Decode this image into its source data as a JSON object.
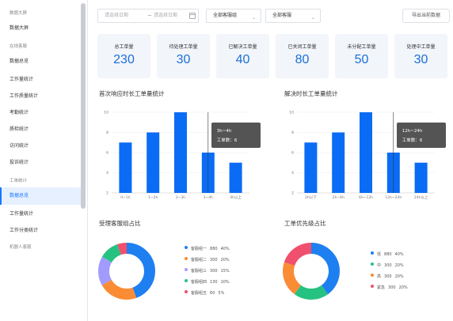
{
  "sidebar": {
    "items": [
      {
        "label": "数据大屏",
        "type": "group"
      },
      {
        "label": "数据大屏",
        "type": "item"
      },
      {
        "label": "在线客服",
        "type": "group"
      },
      {
        "label": "数据总览",
        "type": "item"
      },
      {
        "label": "工作量统计",
        "type": "item"
      },
      {
        "label": "工作质量统计",
        "type": "item"
      },
      {
        "label": "考勤统计",
        "type": "item"
      },
      {
        "label": "质检统计",
        "type": "item"
      },
      {
        "label": "访问统计",
        "type": "item"
      },
      {
        "label": "投诉统计",
        "type": "item"
      },
      {
        "label": "工单统计",
        "type": "group"
      },
      {
        "label": "数据总览",
        "type": "active"
      },
      {
        "label": "工作量统计",
        "type": "item"
      },
      {
        "label": "工作分类统计",
        "type": "item"
      },
      {
        "label": "机器人客服",
        "type": "group"
      }
    ]
  },
  "filters": {
    "start_date_placeholder": "请选择日期",
    "separator": "~",
    "end_date_placeholder": "请选择日期",
    "group_select": "全部客服组",
    "agent_select": "全部客服",
    "export_label": "导出当前数据"
  },
  "stats": [
    {
      "label": "总工单量",
      "value": "230"
    },
    {
      "label": "待处理工单量",
      "value": "30"
    },
    {
      "label": "已解决工单量",
      "value": "40"
    },
    {
      "label": "已关闭工单量",
      "value": "80"
    },
    {
      "label": "未分配工单量",
      "value": "50"
    },
    {
      "label": "处理中工单量",
      "value": "30"
    }
  ],
  "colors": {
    "accent": "#1677ff",
    "bar": "#0a6cf5",
    "card_bg": "#f2f5fa",
    "value_text": "#1a6fd8"
  },
  "chart_data": [
    {
      "type": "bar",
      "title": "首次响应时长工单量统计",
      "categories": [
        "0~1h",
        "1~2h",
        "2~3h",
        "3~4h",
        "4h以上"
      ],
      "values": [
        7,
        8,
        10,
        6,
        5
      ],
      "ylim": [
        2,
        10
      ],
      "yticks": [
        "2",
        "4",
        "6",
        "8",
        "10"
      ],
      "highlight_index": 3,
      "tooltip": {
        "title": "3h~4h",
        "label": "工单数：",
        "value": "6"
      }
    },
    {
      "type": "bar",
      "title": "解决时长工单量统计",
      "categories": [
        "2h以下",
        "2h~6h",
        "6h~12h",
        "12h~24h",
        "24h以上"
      ],
      "values": [
        7,
        8,
        10,
        6,
        5
      ],
      "ylim": [
        2,
        10
      ],
      "yticks": [
        "2",
        "4",
        "6",
        "8",
        "10"
      ],
      "highlight_index": 3,
      "tooltip": {
        "title": "12h~24h",
        "label": "工单数：",
        "value": "6"
      }
    },
    {
      "type": "pie",
      "title": "受理客服组占比",
      "slices": [
        {
          "name": "客服组一",
          "count": "880",
          "pct": "40%",
          "value": 40,
          "color": "#1e7ff0"
        },
        {
          "name": "客服组二",
          "count": "300",
          "pct": "20%",
          "value": 20,
          "color": "#fa8c35"
        },
        {
          "name": "客服组三",
          "count": "300",
          "pct": "15%",
          "value": 15,
          "color": "#a29bfe"
        },
        {
          "name": "客服组四",
          "count": "130",
          "pct": "10%",
          "value": 10,
          "color": "#26c281"
        },
        {
          "name": "客服组五",
          "count": "60",
          "pct": "5%",
          "value": 5,
          "color": "#f0506e"
        }
      ]
    },
    {
      "type": "pie",
      "title": "工单优先级占比",
      "slices": [
        {
          "name": "低",
          "count": "880",
          "pct": "40%",
          "value": 40,
          "color": "#1e7ff0"
        },
        {
          "name": "中",
          "count": "300",
          "pct": "20%",
          "value": 20,
          "color": "#26c281"
        },
        {
          "name": "高",
          "count": "300",
          "pct": "20%",
          "value": 20,
          "color": "#fa8c35"
        },
        {
          "name": "紧急",
          "count": "300",
          "pct": "20%",
          "value": 20,
          "color": "#f0506e"
        }
      ]
    }
  ]
}
